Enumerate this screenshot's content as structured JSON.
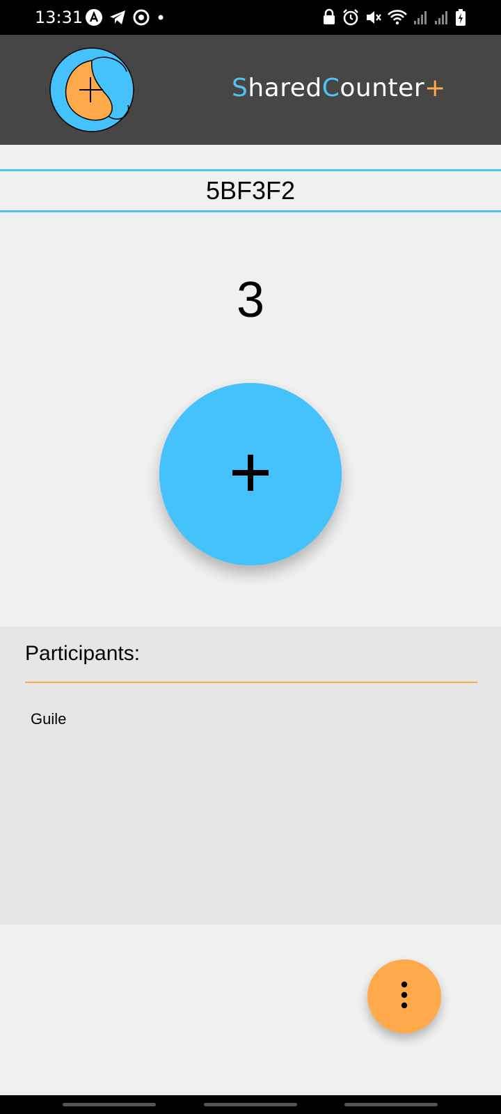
{
  "status_bar": {
    "time": "13:31",
    "left_icons": [
      "app-icon",
      "telegram-icon",
      "sync-icon",
      "dot-icon"
    ],
    "right_icons": [
      "lock-icon",
      "alarm-icon",
      "mute-icon",
      "wifi-icon",
      "signal-icon",
      "signal-icon",
      "battery-icon"
    ]
  },
  "app_bar": {
    "logo": "app-logo-icon",
    "title_parts": {
      "s": "S",
      "hared": "hared",
      "c": "C",
      "ounter": "ounter",
      "plus": "+"
    },
    "colors": {
      "background": "#464646",
      "accent_blue": "#4fc3f7",
      "accent_orange": "#ffa94d"
    }
  },
  "session": {
    "code": "5BF3F2"
  },
  "counter": {
    "value": "3",
    "increment_icon": "plus-icon",
    "button_color": "#45c1fb"
  },
  "participants": {
    "title": "Participants:",
    "items": [
      "Guile"
    ]
  },
  "fab": {
    "icon": "more-vert-icon",
    "color": "#ffa94d"
  }
}
